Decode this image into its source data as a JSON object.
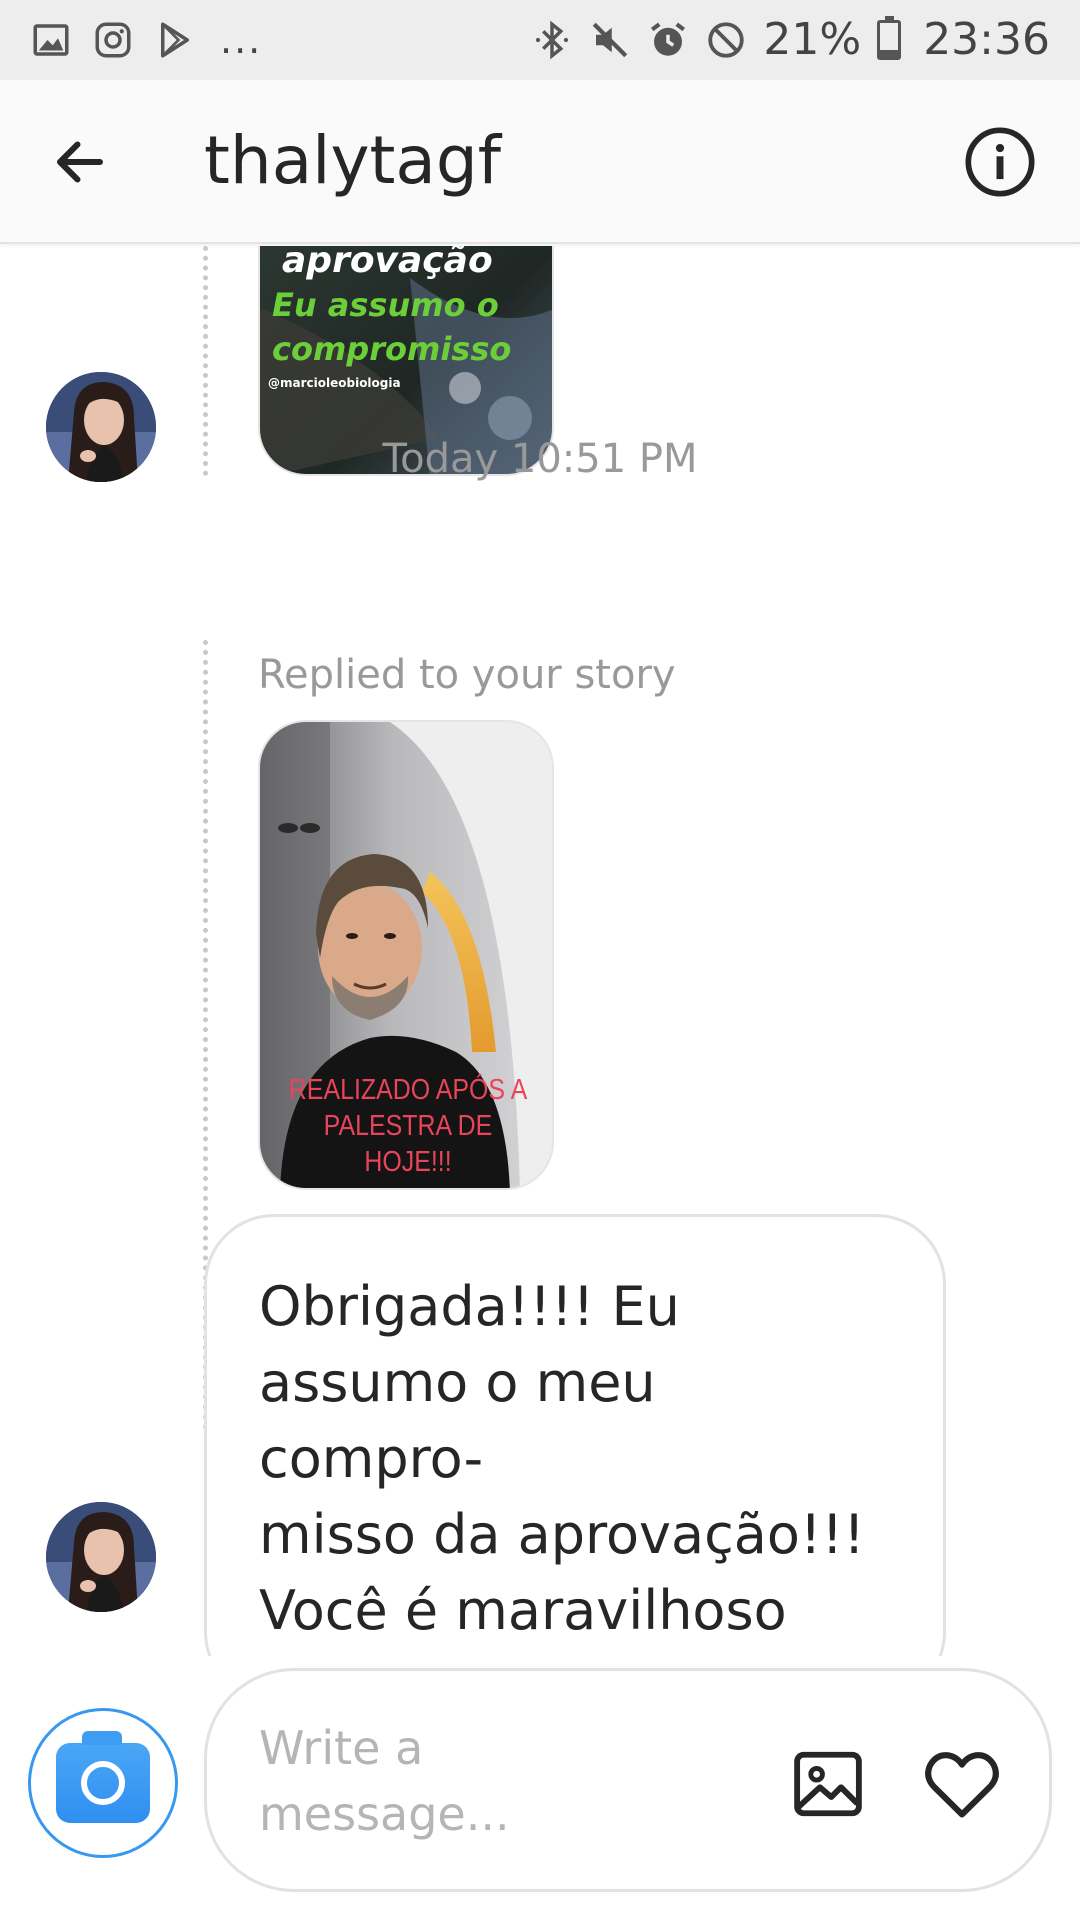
{
  "status_bar": {
    "battery_percent": "21%",
    "time": "23:36",
    "overflow": "...",
    "left_icons": [
      "gallery-icon",
      "instagram-icon",
      "play-store-icon"
    ],
    "right_icons": [
      "bluetooth-icon",
      "mute-icon",
      "alarm-icon",
      "do-not-disturb-icon",
      "battery-icon"
    ],
    "battery_level": 0.21
  },
  "header": {
    "username": "thalytagf",
    "back_icon": "arrow-left-icon",
    "info_icon": "info-icon"
  },
  "thread": {
    "story1": {
      "lines": [
        "aprovação",
        "Eu assumo o",
        "compromisso"
      ],
      "handle": "@marcioleobiologia"
    },
    "timestamp": "Today 10:51 PM",
    "replied_label": "Replied to your story",
    "story2": {
      "caption_line1": "REALIZADO APÓS A",
      "caption_line2": "PALESTRA DE HOJE!!!"
    },
    "message": "Obrigada!!!! Eu\nassumo o meu compro-\nmisso da aprovação!!!\nVocê é maravilhoso"
  },
  "composer": {
    "placeholder": "Write a\nmessage...",
    "camera_icon": "camera-icon",
    "gallery_icon": "gallery-icon",
    "like_icon": "heart-icon"
  },
  "colors": {
    "accent": "#3897f0",
    "story_green": "#6ccf3a",
    "story_red": "#e8445a",
    "muted_text": "#999999"
  }
}
